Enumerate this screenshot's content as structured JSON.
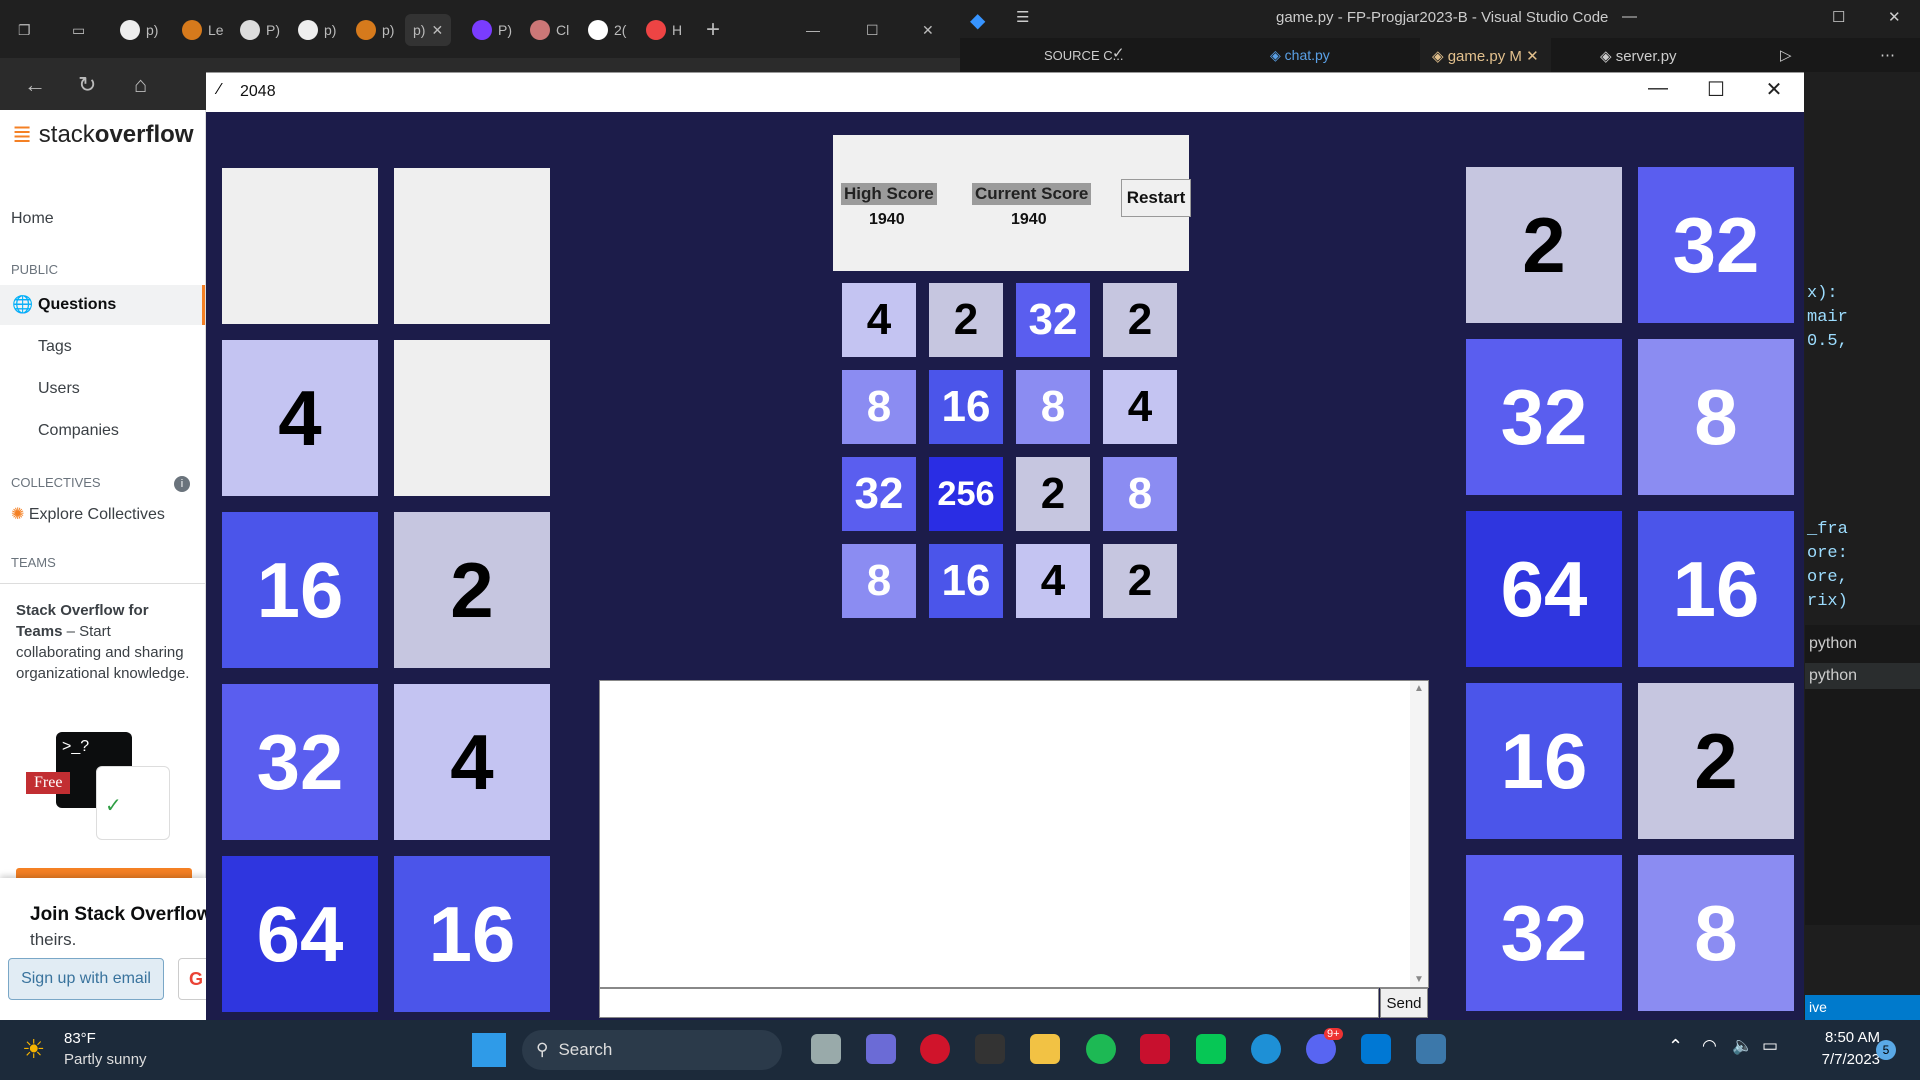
{
  "edge": {
    "tabs": [
      "p)",
      "Le",
      "P)",
      "p)",
      "p)",
      "p)",
      "P)",
      "Cl",
      "2(",
      "H"
    ]
  },
  "vscode": {
    "title": "game.py - FP-Progjar2023-B - Visual Studio Code",
    "source_control": "SOURCE C...",
    "tabs": [
      "chat.py",
      "game.py M",
      "server.py"
    ],
    "code_snippets": [
      "x):",
      "mair",
      "0.5,",
      "_fra",
      "ore:",
      "ore,",
      "rix)"
    ],
    "terminals": [
      "python",
      "python"
    ],
    "status": "ive"
  },
  "stackoverflow": {
    "logo_a": "stack",
    "logo_b": "overflow",
    "nav": [
      "Home",
      "PUBLIC",
      "Questions",
      "Tags",
      "Users",
      "Companies",
      "COLLECTIVES",
      "Explore Collectives",
      "TEAMS"
    ],
    "teams_title": "Stack Overflow for Teams",
    "teams_text": "– Start collaborating and sharing organizational knowledge.",
    "free_badge": "Free",
    "join_title": "Join Stack Overflow",
    "join_text": "theirs.",
    "signup": "Sign up with email"
  },
  "game": {
    "window_title": "2048",
    "high_score_label": "High Score",
    "high_score": "1940",
    "current_score_label": "Current Score",
    "current_score": "1940",
    "restart_label": "Restart",
    "send_label": "Send",
    "center_board": [
      [
        "4",
        "2",
        "32",
        "2"
      ],
      [
        "8",
        "16",
        "8",
        "4"
      ],
      [
        "32",
        "256",
        "2",
        "8"
      ],
      [
        "8",
        "16",
        "4",
        "2"
      ]
    ],
    "left_board": [
      [
        "",
        ""
      ],
      [
        "4",
        ""
      ],
      [
        "16",
        "2"
      ],
      [
        "32",
        "4"
      ],
      [
        "64",
        "16"
      ]
    ],
    "right_board": [
      [
        "2",
        "32"
      ],
      [
        "32",
        "8"
      ],
      [
        "64",
        "16"
      ],
      [
        "16",
        "2"
      ],
      [
        "32",
        "8"
      ]
    ],
    "tile_colors": {
      "empty": "#efefef",
      "2": "#c6c6e0",
      "4": "#c4c4f2",
      "8": "#8b8cf2",
      "16": "#4b55ea",
      "32": "#5a5eef",
      "64": "#2f36df",
      "256": "#2a2de4"
    }
  },
  "taskbar": {
    "weather_temp": "83°F",
    "weather_text": "Partly sunny",
    "search": "Search",
    "time": "8:50 AM",
    "date": "7/7/2023",
    "badge": "5",
    "discord_badge": "9+"
  }
}
